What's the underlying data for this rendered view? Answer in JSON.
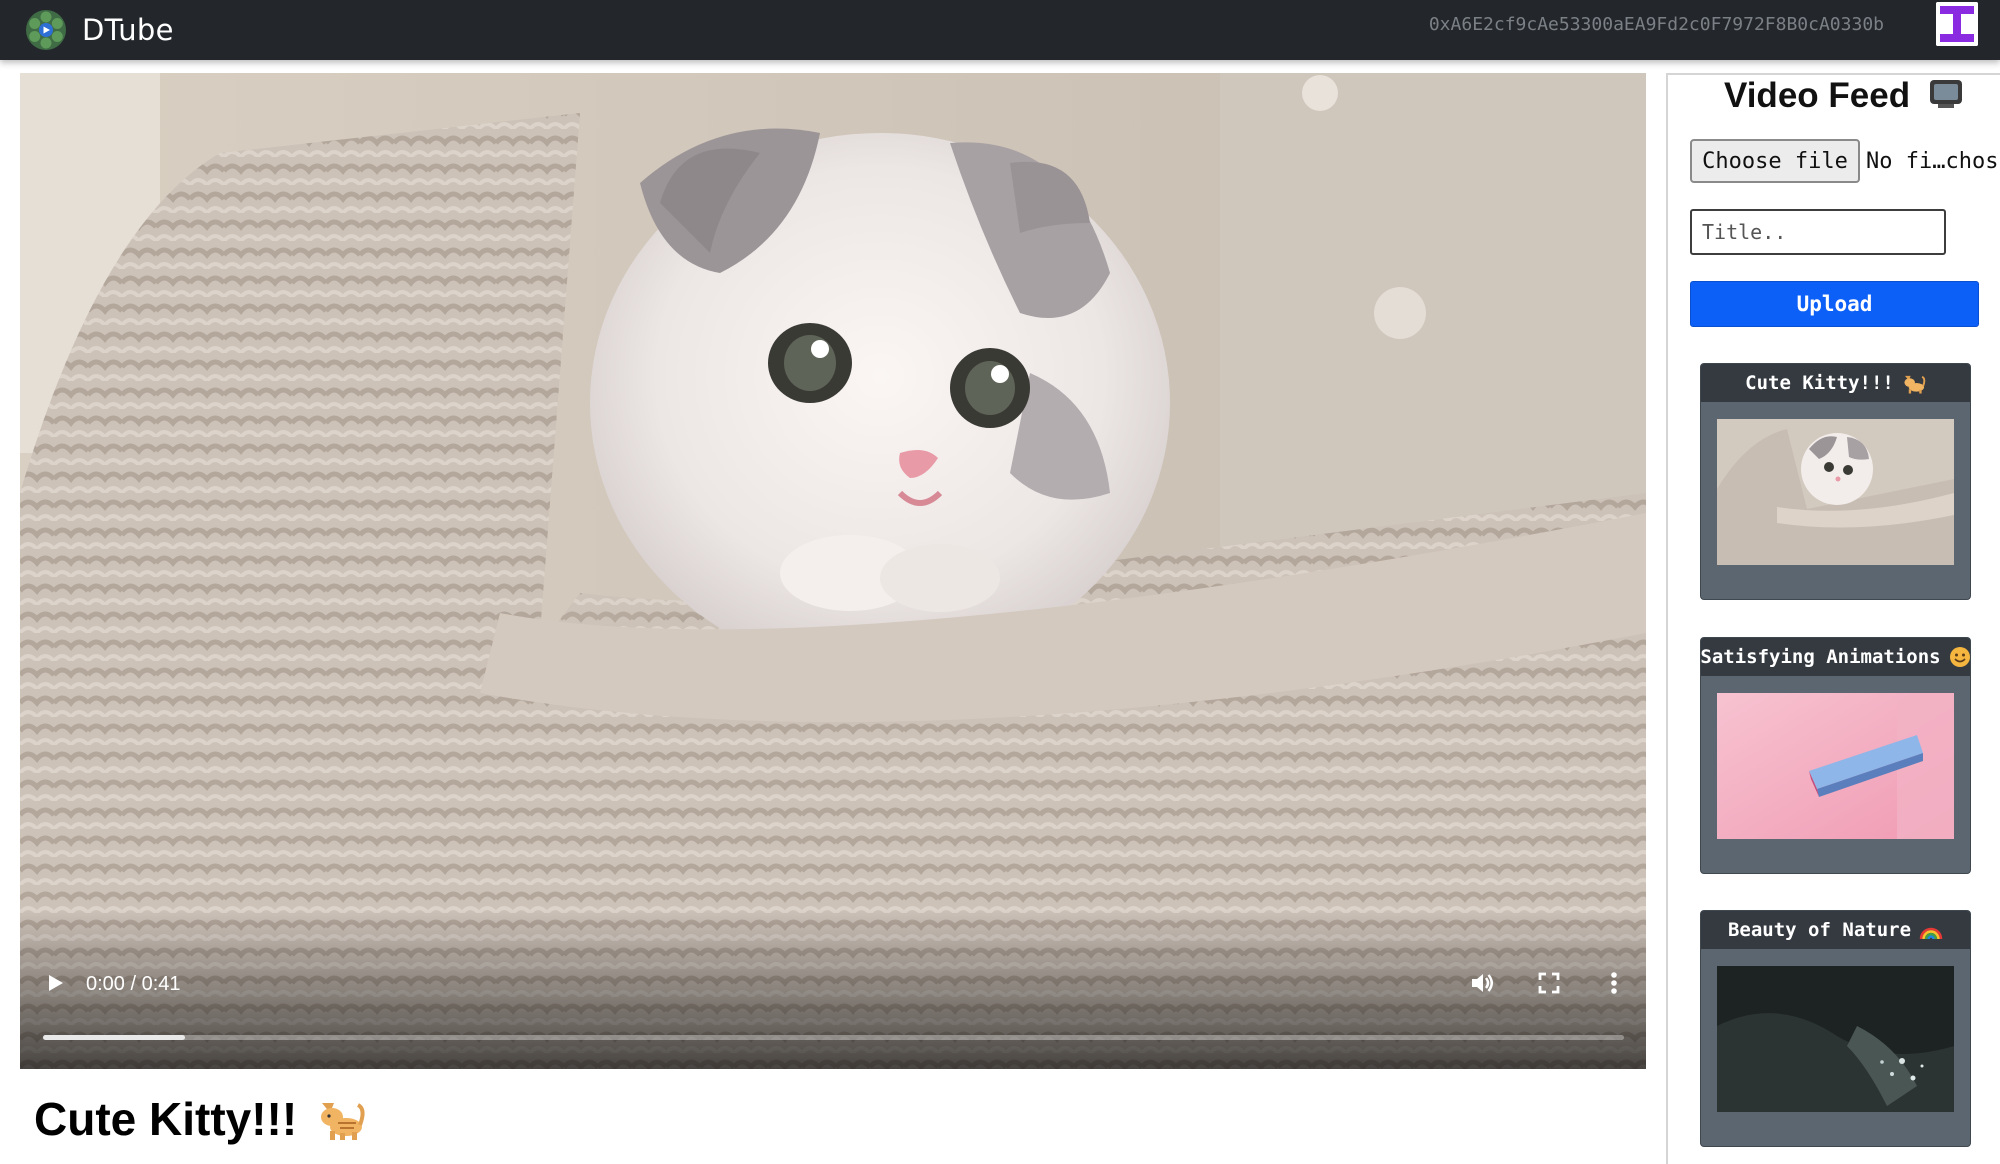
{
  "header": {
    "brand": "DTube",
    "account": "0xA6E2cf9cAe53300aEA9Fd2c0F7972F8B0cA0330b",
    "logo_icon": "film-reel-icon",
    "avatar_icon": "identicon-avatar"
  },
  "player": {
    "time": "0:00 / 0:41",
    "progress": 0.09,
    "icons": [
      "play-icon",
      "volume-icon",
      "fullscreen-icon",
      "more-vert-icon"
    ]
  },
  "current_video": {
    "title": "Cute Kitty!!!",
    "emoji": "cat-emoji"
  },
  "sidebar": {
    "heading": "Video Feed",
    "heading_icon": "tv-emoji",
    "file_button": "Choose file",
    "file_status": "No fi…chos",
    "title_placeholder": "Title..",
    "upload_label": "Upload",
    "videos": [
      {
        "title": "Cute Kitty!!!",
        "emoji": "cat-emoji"
      },
      {
        "title": "Satisfying Animations",
        "emoji": "smiling-face-emoji"
      },
      {
        "title": "Beauty of Nature",
        "emoji": "rainbow-emoji"
      }
    ]
  },
  "colors": {
    "navbar": "#23272b",
    "upload": "#0d60f7",
    "card": "#5b6670",
    "card_header": "#343a40"
  }
}
